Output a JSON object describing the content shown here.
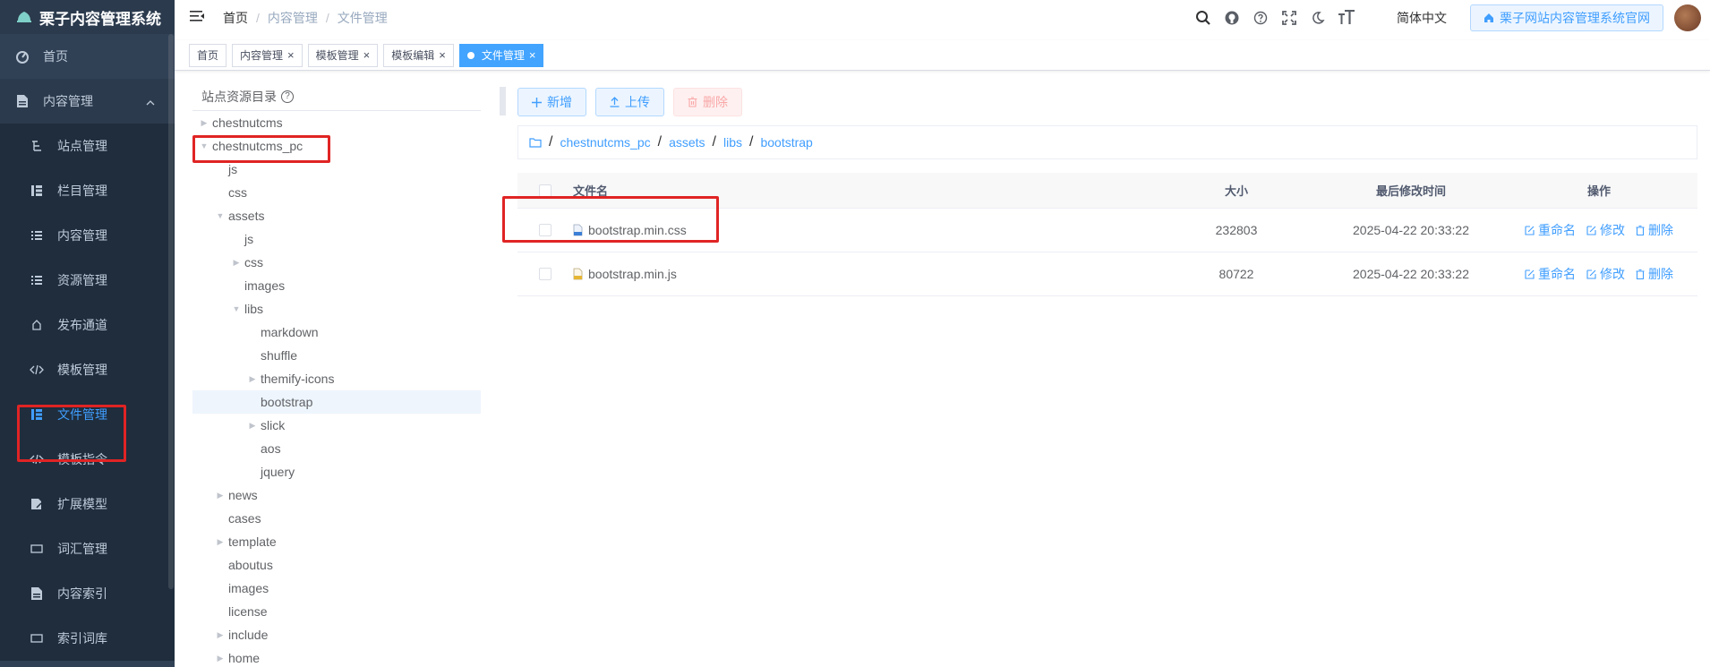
{
  "app": {
    "title": "栗子内容管理系统"
  },
  "sidebar": {
    "home": "首页",
    "content_mgmt": "内容管理",
    "items": [
      {
        "label": "站点管理",
        "icon": "site-icon"
      },
      {
        "label": "栏目管理",
        "icon": "tree-table-icon"
      },
      {
        "label": "内容管理",
        "icon": "list-icon"
      },
      {
        "label": "资源管理",
        "icon": "list-icon"
      },
      {
        "label": "发布通道",
        "icon": "publish-icon"
      },
      {
        "label": "模板管理",
        "icon": "code-icon"
      },
      {
        "label": "文件管理",
        "icon": "tree-table-icon",
        "active": true
      },
      {
        "label": "模板指令",
        "icon": "code-icon"
      },
      {
        "label": "扩展模型",
        "icon": "edit-doc-icon"
      },
      {
        "label": "词汇管理",
        "icon": "rect-icon"
      },
      {
        "label": "内容索引",
        "icon": "doc-icon"
      },
      {
        "label": "索引词库",
        "icon": "rect-icon"
      }
    ]
  },
  "navbar": {
    "breadcrumb": [
      "首页",
      "内容管理",
      "文件管理"
    ],
    "lang": "简体中文",
    "site_button": "栗子网站内容管理系统官网"
  },
  "tags": [
    {
      "label": "首页"
    },
    {
      "label": "内容管理"
    },
    {
      "label": "模板管理"
    },
    {
      "label": "模板编辑"
    },
    {
      "label": "文件管理",
      "active": true
    }
  ],
  "tree": {
    "title": "站点资源目录",
    "nodes": [
      {
        "label": "chestnutcms",
        "arrow": "right"
      },
      {
        "label": "chestnutcms_pc",
        "arrow": "down"
      },
      {
        "label": "js"
      },
      {
        "label": "css"
      },
      {
        "label": "assets",
        "arrow": "down"
      },
      {
        "label": "js"
      },
      {
        "label": "css",
        "arrow": "right"
      },
      {
        "label": "images"
      },
      {
        "label": "libs",
        "arrow": "down"
      },
      {
        "label": "markdown"
      },
      {
        "label": "shuffle"
      },
      {
        "label": "themify-icons",
        "arrow": "right"
      },
      {
        "label": "bootstrap",
        "selected": true
      },
      {
        "label": "slick",
        "arrow": "right"
      },
      {
        "label": "aos"
      },
      {
        "label": "jquery"
      },
      {
        "label": "news",
        "arrow": "right"
      },
      {
        "label": "cases"
      },
      {
        "label": "template",
        "arrow": "right"
      },
      {
        "label": "aboutus"
      },
      {
        "label": "images"
      },
      {
        "label": "license"
      },
      {
        "label": "include",
        "arrow": "right"
      },
      {
        "label": "home",
        "arrow": "right"
      }
    ]
  },
  "toolbar": {
    "add": "新增",
    "upload": "上传",
    "delete": "删除"
  },
  "path": [
    "chestnutcms_pc",
    "assets",
    "libs",
    "bootstrap"
  ],
  "table": {
    "headers": {
      "name": "文件名",
      "size": "大小",
      "time": "最后修改时间",
      "ops": "操作"
    },
    "ops": {
      "rename": "重命名",
      "edit": "修改",
      "delete": "删除"
    },
    "rows": [
      {
        "name": "bootstrap.min.css",
        "size": "232803",
        "time": "2025-04-22 20:33:22"
      },
      {
        "name": "bootstrap.min.js",
        "size": "80722",
        "time": "2025-04-22 20:33:22"
      }
    ]
  }
}
